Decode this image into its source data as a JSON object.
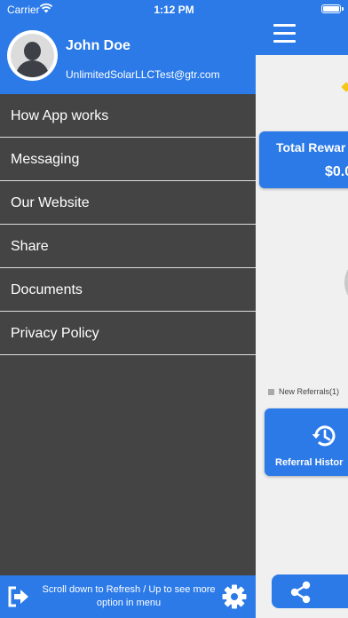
{
  "status_bar": {
    "carrier": "Carrier",
    "time": "1:12 PM"
  },
  "user": {
    "name": "John Doe",
    "email": "UnlimitedSolarLLCTest@gtr.com"
  },
  "menu": {
    "items": [
      {
        "label": "How App works"
      },
      {
        "label": "Messaging"
      },
      {
        "label": "Our Website"
      },
      {
        "label": "Share"
      },
      {
        "label": "Documents"
      },
      {
        "label": "Privacy Policy"
      }
    ]
  },
  "footer": {
    "hint": "Scroll down to Refresh / Up to see more option in menu"
  },
  "main": {
    "rewards_label": "Total Rewar",
    "rewards_amount": "$0.0",
    "legend_label": "New Referrals(1)",
    "history_label": "Referral Histor"
  },
  "colors": {
    "accent": "#2b7ae8",
    "drawer_bg": "#444444",
    "content_bg": "#f0f0f0"
  },
  "icons": [
    "wifi-icon",
    "battery-icon",
    "menu-icon",
    "avatar-icon",
    "logout-icon",
    "gear-icon",
    "history-icon",
    "share-icon"
  ]
}
